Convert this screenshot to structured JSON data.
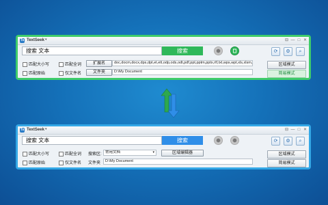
{
  "app": {
    "name": "TextSeek",
    "logo": "Ts"
  },
  "window_controls": {
    "pin": "⊟",
    "minimize": "—",
    "maximize": "□",
    "close": "✕"
  },
  "top": {
    "search_text": "搜索  文本",
    "search_button": "搜索",
    "options": {
      "match_case": "匹配大小写",
      "match_whole": "匹配全词",
      "match_regex": "匹配原始",
      "filename_only": "仅文件名"
    },
    "ext_button": "扩展名",
    "ext_value": "doc,docm,docx,dps,dpt,et,ett,odp,ods,odt,pdf,ppt,pptm,pptx,rtf,txt,wps,wpt,xls,xlsm,xlsx",
    "folder_button": "文件夹",
    "folder_value": "D:\\My Document",
    "mode_button": "区域模式",
    "simple_mode": "简易模式"
  },
  "bottom": {
    "search_text": "搜索  文本",
    "search_button": "搜索",
    "options": {
      "match_case": "匹配大小写",
      "match_whole": "匹配全词",
      "match_regex": "匹配原始",
      "filename_only": "仅文件名"
    },
    "range_label": "搜索区:",
    "range_value": "常用文档",
    "editor_button": "区域编辑器",
    "folder_label": "文件夹",
    "folder_value": "D:\\My Document",
    "mode_button": "区域模式",
    "simple_mode": "简易模式"
  },
  "colors": {
    "top_accent": "#2fb85a",
    "bottom_accent": "#2f8ee8",
    "background": "#1470b8"
  },
  "icons": [
    "app-logo-icon",
    "stop-icon",
    "trash-icon",
    "refresh-icon",
    "settings-icon",
    "search-tool-icon",
    "swap-arrows-icon"
  ]
}
